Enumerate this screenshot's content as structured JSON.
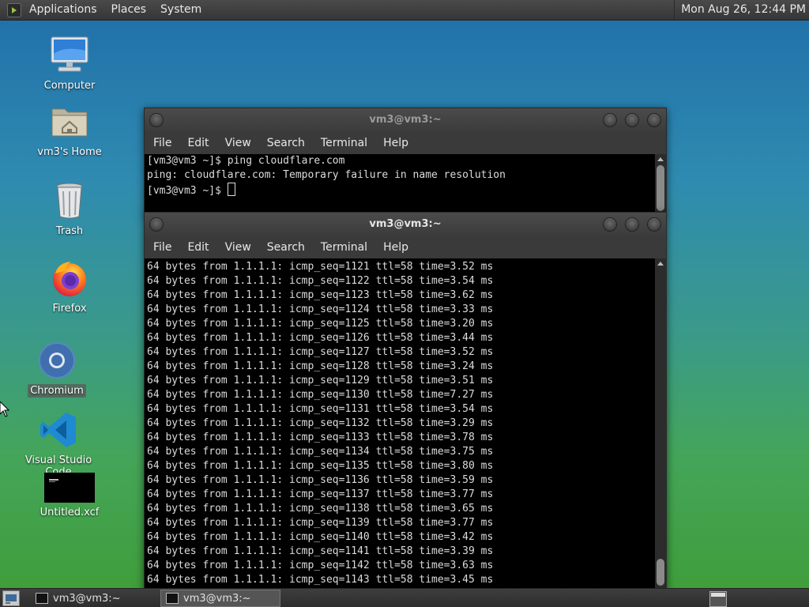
{
  "top_panel": {
    "menus": [
      "Applications",
      "Places",
      "System"
    ],
    "clock": "Mon Aug 26, 12:44 PM"
  },
  "desktop_icons": [
    {
      "label": "Computer",
      "icon": "computer-icon"
    },
    {
      "label": "vm3's Home",
      "icon": "home-folder-icon"
    },
    {
      "label": "Trash",
      "icon": "trash-icon"
    },
    {
      "label": "Firefox",
      "icon": "firefox-icon"
    },
    {
      "label": "Chromium",
      "icon": "chromium-icon"
    },
    {
      "label": "Visual Studio Code",
      "icon": "vscode-icon"
    },
    {
      "label": "Untitled.xcf",
      "icon": "image-file-icon"
    }
  ],
  "window_back": {
    "title": "vm3@vm3:~",
    "menu": [
      "File",
      "Edit",
      "View",
      "Search",
      "Terminal",
      "Help"
    ],
    "lines": [
      "[vm3@vm3 ~]$ ping cloudflare.com",
      "ping: cloudflare.com: Temporary failure in name resolution",
      "[vm3@vm3 ~]$ "
    ]
  },
  "window_front": {
    "title": "vm3@vm3:~",
    "menu": [
      "File",
      "Edit",
      "View",
      "Search",
      "Terminal",
      "Help"
    ],
    "lines": [
      "64 bytes from 1.1.1.1: icmp_seq=1121 ttl=58 time=3.52 ms",
      "64 bytes from 1.1.1.1: icmp_seq=1122 ttl=58 time=3.54 ms",
      "64 bytes from 1.1.1.1: icmp_seq=1123 ttl=58 time=3.62 ms",
      "64 bytes from 1.1.1.1: icmp_seq=1124 ttl=58 time=3.33 ms",
      "64 bytes from 1.1.1.1: icmp_seq=1125 ttl=58 time=3.20 ms",
      "64 bytes from 1.1.1.1: icmp_seq=1126 ttl=58 time=3.44 ms",
      "64 bytes from 1.1.1.1: icmp_seq=1127 ttl=58 time=3.52 ms",
      "64 bytes from 1.1.1.1: icmp_seq=1128 ttl=58 time=3.24 ms",
      "64 bytes from 1.1.1.1: icmp_seq=1129 ttl=58 time=3.51 ms",
      "64 bytes from 1.1.1.1: icmp_seq=1130 ttl=58 time=7.27 ms",
      "64 bytes from 1.1.1.1: icmp_seq=1131 ttl=58 time=3.54 ms",
      "64 bytes from 1.1.1.1: icmp_seq=1132 ttl=58 time=3.29 ms",
      "64 bytes from 1.1.1.1: icmp_seq=1133 ttl=58 time=3.78 ms",
      "64 bytes from 1.1.1.1: icmp_seq=1134 ttl=58 time=3.75 ms",
      "64 bytes from 1.1.1.1: icmp_seq=1135 ttl=58 time=3.80 ms",
      "64 bytes from 1.1.1.1: icmp_seq=1136 ttl=58 time=3.59 ms",
      "64 bytes from 1.1.1.1: icmp_seq=1137 ttl=58 time=3.77 ms",
      "64 bytes from 1.1.1.1: icmp_seq=1138 ttl=58 time=3.65 ms",
      "64 bytes from 1.1.1.1: icmp_seq=1139 ttl=58 time=3.77 ms",
      "64 bytes from 1.1.1.1: icmp_seq=1140 ttl=58 time=3.42 ms",
      "64 bytes from 1.1.1.1: icmp_seq=1141 ttl=58 time=3.39 ms",
      "64 bytes from 1.1.1.1: icmp_seq=1142 ttl=58 time=3.63 ms",
      "64 bytes from 1.1.1.1: icmp_seq=1143 ttl=58 time=3.45 ms"
    ]
  },
  "taskbar": {
    "tasks": [
      {
        "label": "vm3@vm3:~",
        "active": false
      },
      {
        "label": "vm3@vm3:~",
        "active": true
      }
    ]
  },
  "colors": {
    "panel": "#3a3a3a",
    "terminal_bg": "#000000",
    "terminal_fg": "#dcdcdc"
  }
}
